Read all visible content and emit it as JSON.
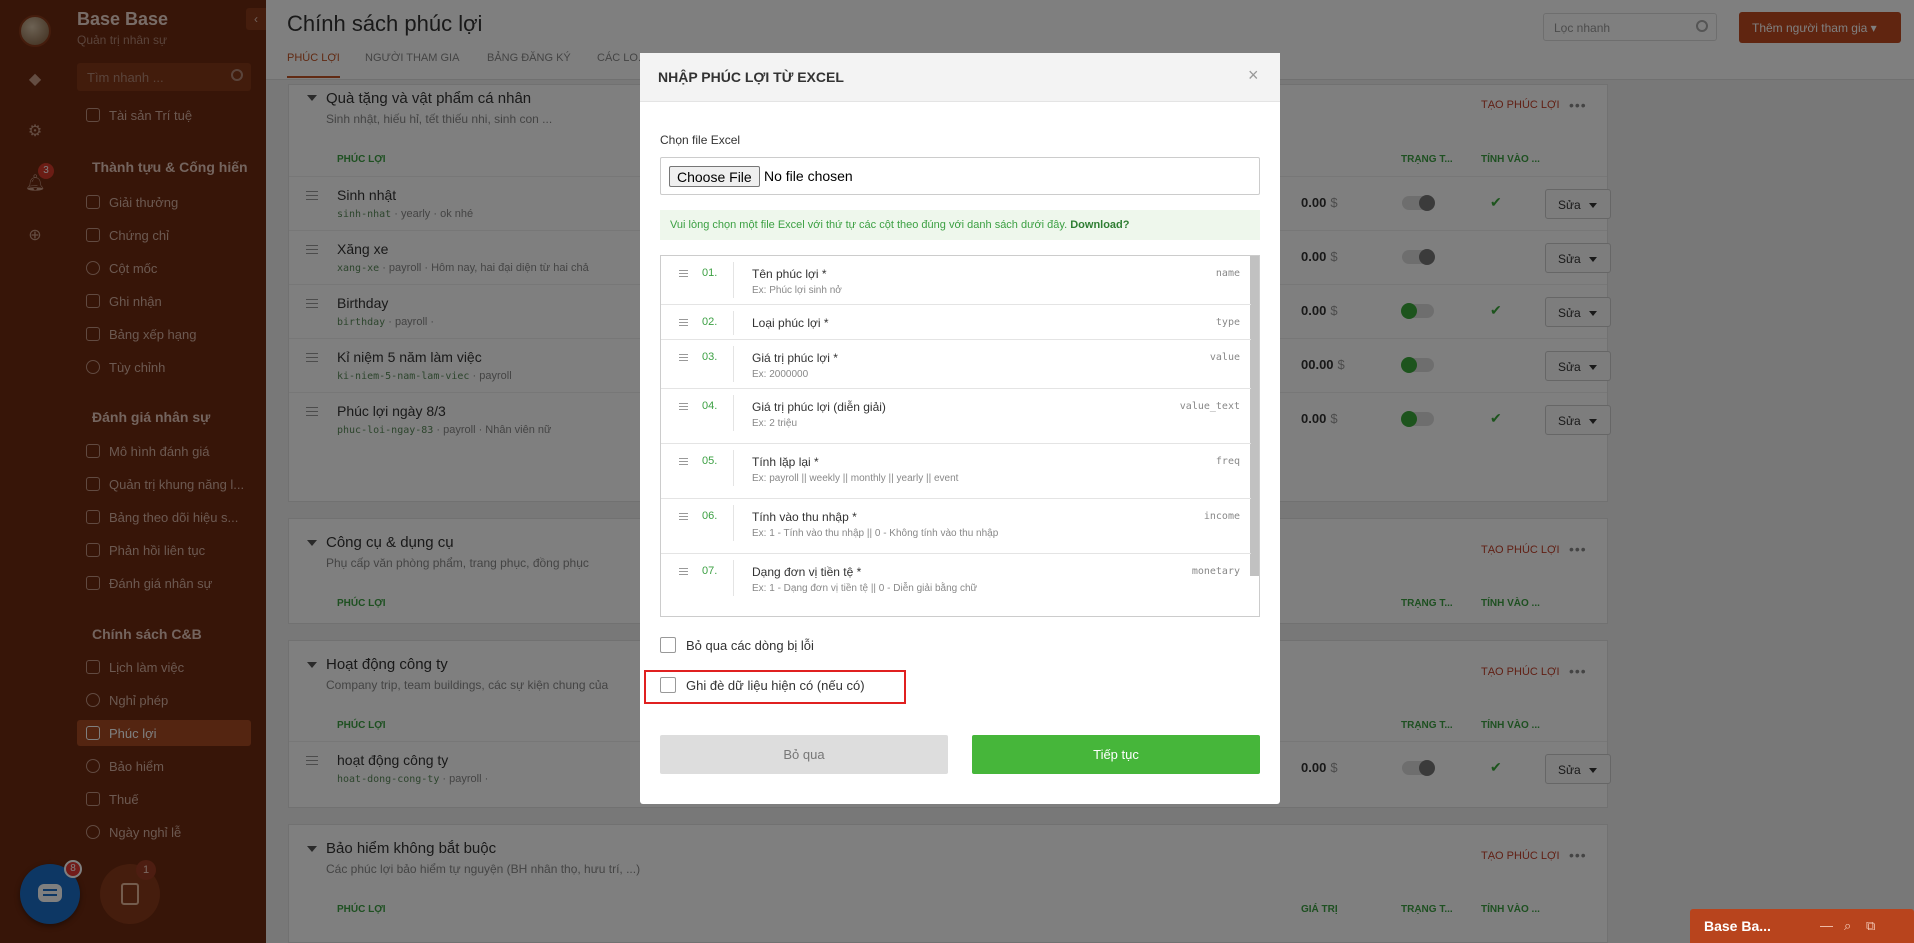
{
  "rail": {
    "notif_badge": "3"
  },
  "sidebar": {
    "title": "Base Base",
    "subtitle": "Quản trị nhân sự",
    "collapse_icon": "‹",
    "search_placeholder": "Tìm nhanh ...",
    "groups": [
      "Thành tựu & Cống hiến",
      "Đánh giá nhân sự",
      "Chính sách C&B"
    ],
    "items": [
      "Tài sản Trí tuệ",
      "Giải thưởng",
      "Chứng chỉ",
      "Cột mốc",
      "Ghi nhận",
      "Bảng xếp hạng",
      "Tùy chỉnh",
      "Mô hình đánh giá",
      "Quản trị khung năng l...",
      "Bảng theo dõi hiệu s...",
      "Phản hồi liên tục",
      "Đánh giá nhân sự",
      "Lịch làm việc",
      "Nghỉ phép",
      "Phúc lợi",
      "Bảo hiểm",
      "Thuế",
      "Ngày nghỉ lễ"
    ]
  },
  "float_buttons": {
    "chat_badge": "8",
    "task_badge": "1"
  },
  "header": {
    "title": "Chính sách phúc lợi",
    "tabs": [
      "PHÚC LỢI",
      "NGƯỜI THAM GIA",
      "BẢNG ĐĂNG KÝ",
      "CÁC LO..."
    ],
    "quick_filter": "Lọc nhanh",
    "add_button": "Thêm người tham gia"
  },
  "sections": [
    {
      "title": "Quà tặng và vật phẩm cá nhân",
      "desc": "Sinh nhật, hiếu hỉ, tết thiếu nhi, sinh con ...",
      "create": "TẠO PHÚC LỢI",
      "col_name": "PHÚC LỢI",
      "col_status": "TRẠNG T...",
      "col_income": "TÍNH VÀO ...",
      "rows": [
        {
          "name": "Sinh nhật",
          "code": "sinh-nhat",
          "meta": " · yearly · ok nhé",
          "value": "0.00",
          "toggle": "off",
          "check": true
        },
        {
          "name": "Xăng xe",
          "code": "xang-xe",
          "meta": " · payroll · Hôm nay, hai đại diện từ hai chả",
          "value": "0.00",
          "toggle": "off",
          "check": false
        },
        {
          "name": "Birthday",
          "code": "birthday",
          "meta": " · payroll ·",
          "value": "0.00",
          "toggle": "on",
          "check": true
        },
        {
          "name": "Kỉ niệm 5 năm làm việc",
          "code": "ki-niem-5-nam-lam-viec",
          "meta": " · payroll",
          "value": "00.00",
          "toggle": "on",
          "check": false
        },
        {
          "name": "Phúc lợi ngày 8/3",
          "code": "phuc-loi-ngay-83",
          "meta": " · payroll · Nhân viên nữ",
          "value": "0.00",
          "toggle": "on",
          "check": true
        }
      ]
    },
    {
      "title": "Công cụ & dụng cụ",
      "desc": "Phụ cấp văn phòng phẩm, trang phục, đồng phục",
      "create": "TẠO PHÚC LỢI",
      "col_name": "PHÚC LỢI",
      "col_status": "TRẠNG T...",
      "col_income": "TÍNH VÀO ..."
    },
    {
      "title": "Hoạt động công ty",
      "desc": "Company trip, team buildings, các sự kiện chung của",
      "create": "TẠO PHÚC LỢI",
      "col_name": "PHÚC LỢI",
      "col_status": "TRẠNG T...",
      "col_income": "TÍNH VÀO ...",
      "rows": [
        {
          "name": "hoạt động công ty",
          "code": "hoat-dong-cong-ty",
          "meta": " · payroll ·",
          "value": "0.00",
          "toggle": "off",
          "check": true
        }
      ]
    },
    {
      "title": "Bảo hiểm không bắt buộc",
      "desc": "Các phúc lợi bảo hiểm tự nguyện (BH nhân thọ, hưu trí, ...)",
      "create": "TẠO PHÚC LỢI",
      "col_name": "PHÚC LỢI",
      "col_value": "GIÁ TRỊ",
      "col_status": "TRẠNG T...",
      "col_income": "TÍNH VÀO ..."
    }
  ],
  "edit_label": "Sửa",
  "currency": "$",
  "modal": {
    "title": "NHẬP PHÚC LỢI TỪ EXCEL",
    "close": "×",
    "file_label": "Chọn file Excel",
    "file_button": "Choose File",
    "file_status": "No file chosen",
    "notice": "Vui lòng chọn một file Excel với thứ tự các cột theo đúng với danh sách dưới đây.",
    "notice_link": "Download?",
    "fields": [
      {
        "num": "01.",
        "name": "Tên phúc lợi *",
        "ex": "Ex: Phúc lợi sinh nở",
        "key": "name"
      },
      {
        "num": "02.",
        "name": "Loại phúc lợi *",
        "ex": "",
        "key": "type"
      },
      {
        "num": "03.",
        "name": "Giá trị phúc lợi *",
        "ex": "Ex: 2000000",
        "key": "value"
      },
      {
        "num": "04.",
        "name": "Giá trị phúc lợi (diễn giải)",
        "ex": "Ex: 2 triệu",
        "key": "value_text"
      },
      {
        "num": "05.",
        "name": "Tính lặp lại *",
        "ex": "Ex: payroll || weekly || monthly || yearly || event",
        "key": "freq"
      },
      {
        "num": "06.",
        "name": "Tính vào thu nhập *",
        "ex": "Ex: 1 - Tính vào thu nhập || 0 - Không tính vào thu nhập",
        "key": "income"
      },
      {
        "num": "07.",
        "name": "Dạng đơn vị tiền tệ *",
        "ex": "Ex: 1 - Dạng đơn vị tiền tệ || 0 - Diễn giải bằng chữ",
        "key": "monetary"
      }
    ],
    "skip_errors": "Bỏ qua các dòng bị lỗi",
    "overwrite": "Ghi đè dữ liệu hiện có (nếu có)",
    "cancel": "Bỏ qua",
    "continue": "Tiếp tục"
  },
  "mini_chat": {
    "title": "Base Ba..."
  }
}
